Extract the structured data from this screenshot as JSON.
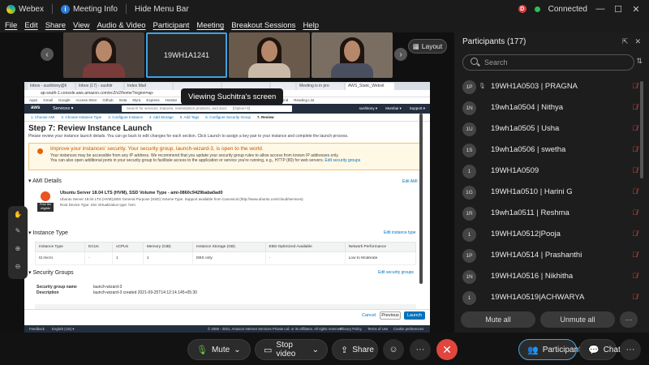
{
  "topbar": {
    "app_name": "Webex",
    "meeting_info": "Meeting Info",
    "hide_menu": "Hide Menu Bar",
    "conn_badge": "D",
    "status": "Connected"
  },
  "menu": [
    "File",
    "Edit",
    "Share",
    "View",
    "Audio & Video",
    "Participant",
    "Meeting",
    "Breakout Sessions",
    "Help"
  ],
  "video_strip": {
    "active_label": "19WH1A1241",
    "layout_label": "Layout"
  },
  "share_tooltip": "Viewing Suchitra's screen",
  "browser": {
    "tabs": [
      "Inbox - sushitony@li",
      "Inbox (17) - sushitr",
      "Index Mail",
      "",
      "",
      "",
      "Meeting is in pro",
      "AWS_Static_Websit"
    ],
    "url": "ap-south-1.console.aws.amazon.com/ec2/v2/home?region=ap-",
    "bookmarks": [
      "Apps",
      "Gmail",
      "Google",
      "Access Sites",
      "Github",
      "Insta",
      "Myra",
      "Express",
      "Hotstar",
      "HTTP",
      "Mongoose",
      "MongoDB",
      "Mern",
      "JS Bin",
      "SendGrid",
      "Reading List"
    ]
  },
  "aws": {
    "logo": "aws",
    "services": "Services ▾",
    "search_placeholder": "Search for services, features, marketplace products, and docs",
    "shortcut": "[Option+S]",
    "account": "sushitony ▾",
    "region": "Mumbai ▾",
    "support": "Support ▾",
    "steps": [
      "1. Choose AMI",
      "2. Choose Instance Type",
      "3. Configure Instance",
      "4. Add Storage",
      "5. Add Tags",
      "6. Configure Security Group",
      "7. Review"
    ],
    "page_title": "Step 7: Review Instance Launch",
    "page_desc": "Please review your instance launch details. You can go back to edit changes for each section. Click Launch to assign a key pair to your instance and complete the launch process.",
    "warn_title": "Improve your instances' security. Your security group, launch-wizard-3, is open to the world.",
    "warn_line1": "Your instances may be accessible from any IP address. We recommend that you update your security group rules to allow access from known IP addresses only.",
    "warn_line2": "You can also open additional ports in your security group to facilitate access to the application or service you're running, e.g., HTTP (80) for web servers.",
    "warn_link": "Edit security groups",
    "ami_section": "AMI Details",
    "edit_ami": "Edit AMI",
    "ami_name": "Ubuntu Server 18.04 LTS (HVM), SSD Volume Type - ami-0860c9429baba0ad0",
    "ami_desc": "Ubuntu Server 18.04 LTS (HVM),EBS General Purpose (SSD) Volume Type. Support available from Canonical (http://www.ubuntu.com/cloud/services).",
    "ami_meta": "Root Device Type: ebs     Virtualization type: hvm",
    "free_tier": "Free tier eligible",
    "instance_section": "Instance Type",
    "edit_instance": "Edit instance type",
    "instance_headers": [
      "Instance Type",
      "ECUs",
      "vCPUs",
      "Memory (GiB)",
      "Instance Storage (GB)",
      "EBS-Optimized Available",
      "Network Performance"
    ],
    "instance_row": [
      "t2.micro",
      "-",
      "1",
      "1",
      "EBS only",
      "-",
      "Low to Moderate"
    ],
    "sg_section": "Security Groups",
    "edit_sg": "Edit security groups",
    "sg_name_label": "Security group name",
    "sg_name": "launch-wizard-3",
    "sg_desc_label": "Description",
    "sg_desc": "launch-wizard-3 created 2021-09-25T14:12:14.145+05:30",
    "cancel": "Cancel",
    "previous": "Previous",
    "launch": "Launch",
    "footer_feedback": "Feedback",
    "footer_lang": "English (US) ▾",
    "footer_copy": "© 2008 - 2021, Amazon Internet Services Private Ltd. or its affiliates. All rights reserved.",
    "footer_privacy": "Privacy Policy",
    "footer_terms": "Terms of Use",
    "footer_cookie": "Cookie preferences"
  },
  "panel": {
    "title": "Participants (177)",
    "search_placeholder": "Search",
    "participants": [
      {
        "initials": "1P",
        "name": "19WH1A0503 | PRAGNA"
      },
      {
        "initials": "1N",
        "name": "19wh1a0504 | Nithya"
      },
      {
        "initials": "1U",
        "name": "19wh1a0505 | Usha"
      },
      {
        "initials": "1S",
        "name": "19wh1a0506 | swetha"
      },
      {
        "initials": "1",
        "name": "19WH1A0509"
      },
      {
        "initials": "1G",
        "name": "19WH1a0510 | Harini G"
      },
      {
        "initials": "1R",
        "name": "19wh1a0511 | Reshma"
      },
      {
        "initials": "1",
        "name": "19WH1A0512|Pooja"
      },
      {
        "initials": "1P",
        "name": "19WH1A0514 | Prashanthi"
      },
      {
        "initials": "1N",
        "name": "19WH1A0516 | Nikhitha"
      },
      {
        "initials": "1",
        "name": "19WH1A0519|ACHWARYA"
      }
    ],
    "mute_all": "Mute all",
    "unmute_all": "Unmute all"
  },
  "controls": {
    "mute": "Mute",
    "stop_video": "Stop video",
    "share": "Share",
    "participants": "Participants",
    "chat": "Chat"
  }
}
